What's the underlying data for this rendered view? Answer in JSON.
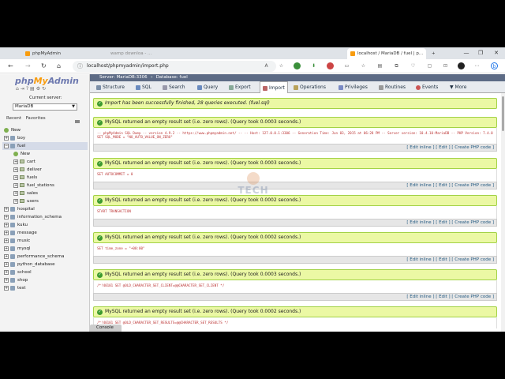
{
  "browser": {
    "tabs": [
      {
        "label": "phpMyAdmin",
        "active": false
      },
      {
        "label": "wamp downloa - ...",
        "active": false
      },
      {
        "label": "localhost / MariaDB / fuel | p...",
        "active": true
      }
    ],
    "new_tab": "+",
    "url": "localhost/phpmyadmin/import.php",
    "window_controls": [
      "—",
      "❐",
      "✕"
    ]
  },
  "sidebar": {
    "logo_php": "php",
    "logo_my": "My",
    "logo_admin": "Admin",
    "current_server_label": "Current server:",
    "current_server_value": "MariaDB",
    "recent": "Recent",
    "favorites": "Favorites",
    "tree": [
      {
        "label": "New",
        "level": 0,
        "type": "new"
      },
      {
        "label": "boy",
        "level": 0,
        "type": "db"
      },
      {
        "label": "fuel",
        "level": 0,
        "type": "db",
        "selected": true
      },
      {
        "label": "New",
        "level": 1,
        "type": "new"
      },
      {
        "label": "cart",
        "level": 1,
        "type": "table"
      },
      {
        "label": "deliver",
        "level": 1,
        "type": "table"
      },
      {
        "label": "fuels",
        "level": 1,
        "type": "table"
      },
      {
        "label": "fuel_stations",
        "level": 1,
        "type": "table"
      },
      {
        "label": "sales",
        "level": 1,
        "type": "table"
      },
      {
        "label": "users",
        "level": 1,
        "type": "table"
      },
      {
        "label": "hospital",
        "level": 0,
        "type": "db"
      },
      {
        "label": "information_schema",
        "level": 0,
        "type": "db"
      },
      {
        "label": "kuku",
        "level": 0,
        "type": "db"
      },
      {
        "label": "message",
        "level": 0,
        "type": "db"
      },
      {
        "label": "music",
        "level": 0,
        "type": "db"
      },
      {
        "label": "mysql",
        "level": 0,
        "type": "db"
      },
      {
        "label": "performance_schema",
        "level": 0,
        "type": "db"
      },
      {
        "label": "python_database",
        "level": 0,
        "type": "db"
      },
      {
        "label": "school",
        "level": 0,
        "type": "db"
      },
      {
        "label": "shop",
        "level": 0,
        "type": "db"
      },
      {
        "label": "test",
        "level": 0,
        "type": "db"
      }
    ]
  },
  "breadcrumb": {
    "server": "Server: MariaDB:3306",
    "database": "Database: fuel"
  },
  "menu": [
    {
      "label": "Structure"
    },
    {
      "label": "SQL"
    },
    {
      "label": "Search"
    },
    {
      "label": "Query"
    },
    {
      "label": "Export"
    },
    {
      "label": "Import"
    },
    {
      "label": "Operations"
    },
    {
      "label": "Privileges"
    },
    {
      "label": "Routines"
    },
    {
      "label": "Events"
    },
    {
      "label": "More"
    }
  ],
  "messages": {
    "import_success": "Import has been successfully finished, 28 queries executed. (fuel.sql)",
    "results": [
      {
        "text": "MySQL returned an empty result set (i.e. zero rows). (Query took 0.0003 seconds.)",
        "sql": "-- phpMyAdmin SQL Dump -- version 4.9.2 -- https://www.phpmyadmin.net/ -- -- Host: 127.0.0.1:3306 -- Generation Time: Jun 03, 2015 at 06:28 PM -- Server version: 10.4.10-MariaDB -- PHP Version: 7.4.0 SET SQL_MODE = \"NO_AUTO_VALUE_ON_ZERO\""
      },
      {
        "text": "MySQL returned an empty result set (i.e. zero rows). (Query took 0.0003 seconds.)",
        "sql": "SET AUTOCOMMIT = 0"
      },
      {
        "text": "MySQL returned an empty result set (i.e. zero rows). (Query took 0.0002 seconds.)",
        "sql": "START TRANSACTION"
      },
      {
        "text": "MySQL returned an empty result set (i.e. zero rows). (Query took 0.0002 seconds.)",
        "sql": "SET time_zone = \"+00:00\""
      },
      {
        "text": "MySQL returned an empty result set (i.e. zero rows). (Query took 0.0003 seconds.)",
        "sql": "/*!40101 SET @OLD_CHARACTER_SET_CLIENT=@@CHARACTER_SET_CLIENT */"
      },
      {
        "text": "MySQL returned an empty result set (i.e. zero rows). (Query took 0.0002 seconds.)",
        "sql": "/*!40101 SET @OLD_CHARACTER_SET_RESULTS=@@CHARACTER_SET_RESULTS */"
      }
    ],
    "actions": "[ Edit inline ] [ Edit ] [ Create PHP code ]"
  },
  "console": "Console",
  "watermark": "TECH",
  "colors": {
    "success_bg": "#ebf8a4",
    "success_border": "#a2d246",
    "breadcrumb_bg": "#5d6b85",
    "logo_blue": "#6c78af",
    "logo_orange": "#f89c0e"
  }
}
